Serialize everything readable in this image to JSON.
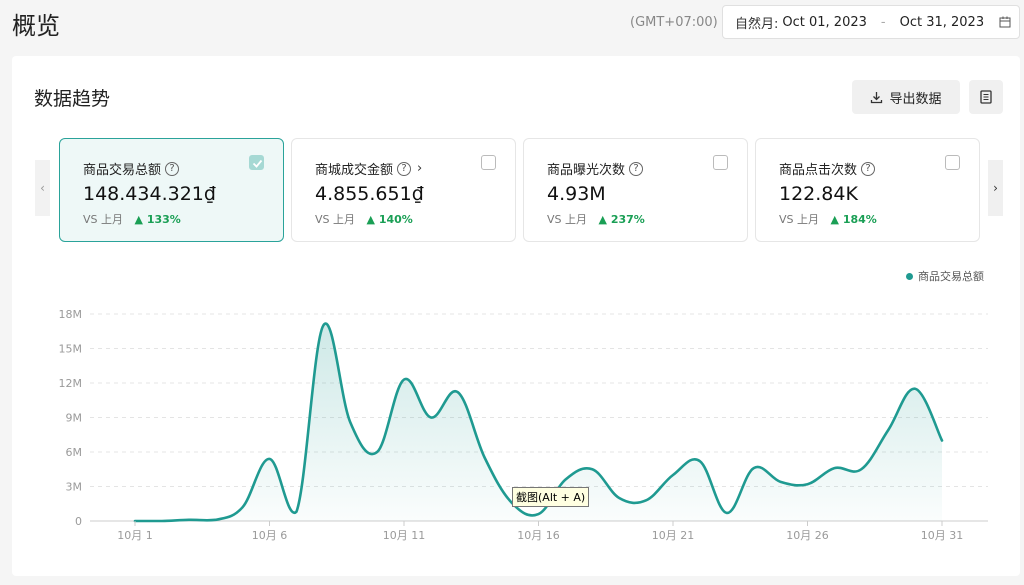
{
  "header": {
    "title": "概览",
    "timezone": "(GMT+07:00)",
    "date_label": "自然月:",
    "date_start": "Oct 01, 2023",
    "date_sep": "-",
    "date_end": "Oct 31, 2023",
    "calendar_icon": "calendar-icon"
  },
  "section": {
    "title": "数据趋势",
    "export_label": "导出数据",
    "export_icon": "download-icon",
    "doc_icon": "document-icon"
  },
  "nav": {
    "prev": "‹",
    "next": "›"
  },
  "metrics": [
    {
      "label": "商品交易总额",
      "value": "148.434.321₫",
      "vs": "VS 上月",
      "delta": "133%",
      "checked": true,
      "has_chevron": false
    },
    {
      "label": "商城成交金额",
      "value": "4.855.651₫",
      "vs": "VS 上月",
      "delta": "140%",
      "checked": false,
      "has_chevron": true
    },
    {
      "label": "商品曝光次数",
      "value": "4.93M",
      "vs": "VS 上月",
      "delta": "237%",
      "checked": false,
      "has_chevron": false
    },
    {
      "label": "商品点击次数",
      "value": "122.84K",
      "vs": "VS 上月",
      "delta": "184%",
      "checked": false,
      "has_chevron": false
    }
  ],
  "legend": {
    "label": "商品交易总额",
    "color": "#1f9a91"
  },
  "tooltip": "截图(Alt + A)",
  "colors": {
    "accent": "#1f9a91",
    "positive": "#1a9f55"
  },
  "chart_data": {
    "type": "area",
    "series": [
      {
        "name": "商品交易总额",
        "x": [
          "10月 1",
          "10月 2",
          "10月 3",
          "10月 4",
          "10月 5",
          "10月 6",
          "10月 7",
          "10月 8",
          "10月 9",
          "10月 10",
          "10月 11",
          "10月 12",
          "10月 13",
          "10月 14",
          "10月 15",
          "10月 16",
          "10月 17",
          "10月 18",
          "10月 19",
          "10月 20",
          "10月 21",
          "10月 22",
          "10月 23",
          "10月 24",
          "10月 25",
          "10月 26",
          "10月 27",
          "10月 28",
          "10月 29",
          "10月 30",
          "10月 31"
        ],
        "values": [
          0,
          0,
          0.1,
          0.1,
          1.2,
          5.4,
          0.8,
          17.0,
          8.6,
          6.0,
          12.3,
          9.0,
          11.2,
          5.5,
          1.6,
          0.6,
          3.6,
          4.5,
          2.0,
          1.8,
          4.0,
          5.2,
          0.7,
          4.6,
          3.4,
          3.2,
          4.6,
          4.5,
          7.9,
          11.5,
          7.0
        ]
      }
    ],
    "xticks": [
      "10月 1",
      "10月 6",
      "10月 11",
      "10月 16",
      "10月 21",
      "10月 26",
      "10月 31"
    ],
    "yticks": [
      "0",
      "3M",
      "6M",
      "9M",
      "12M",
      "15M",
      "18M"
    ],
    "ylim": [
      0,
      18
    ],
    "unit": "M",
    "grid": true,
    "legend_position": "top-right"
  }
}
